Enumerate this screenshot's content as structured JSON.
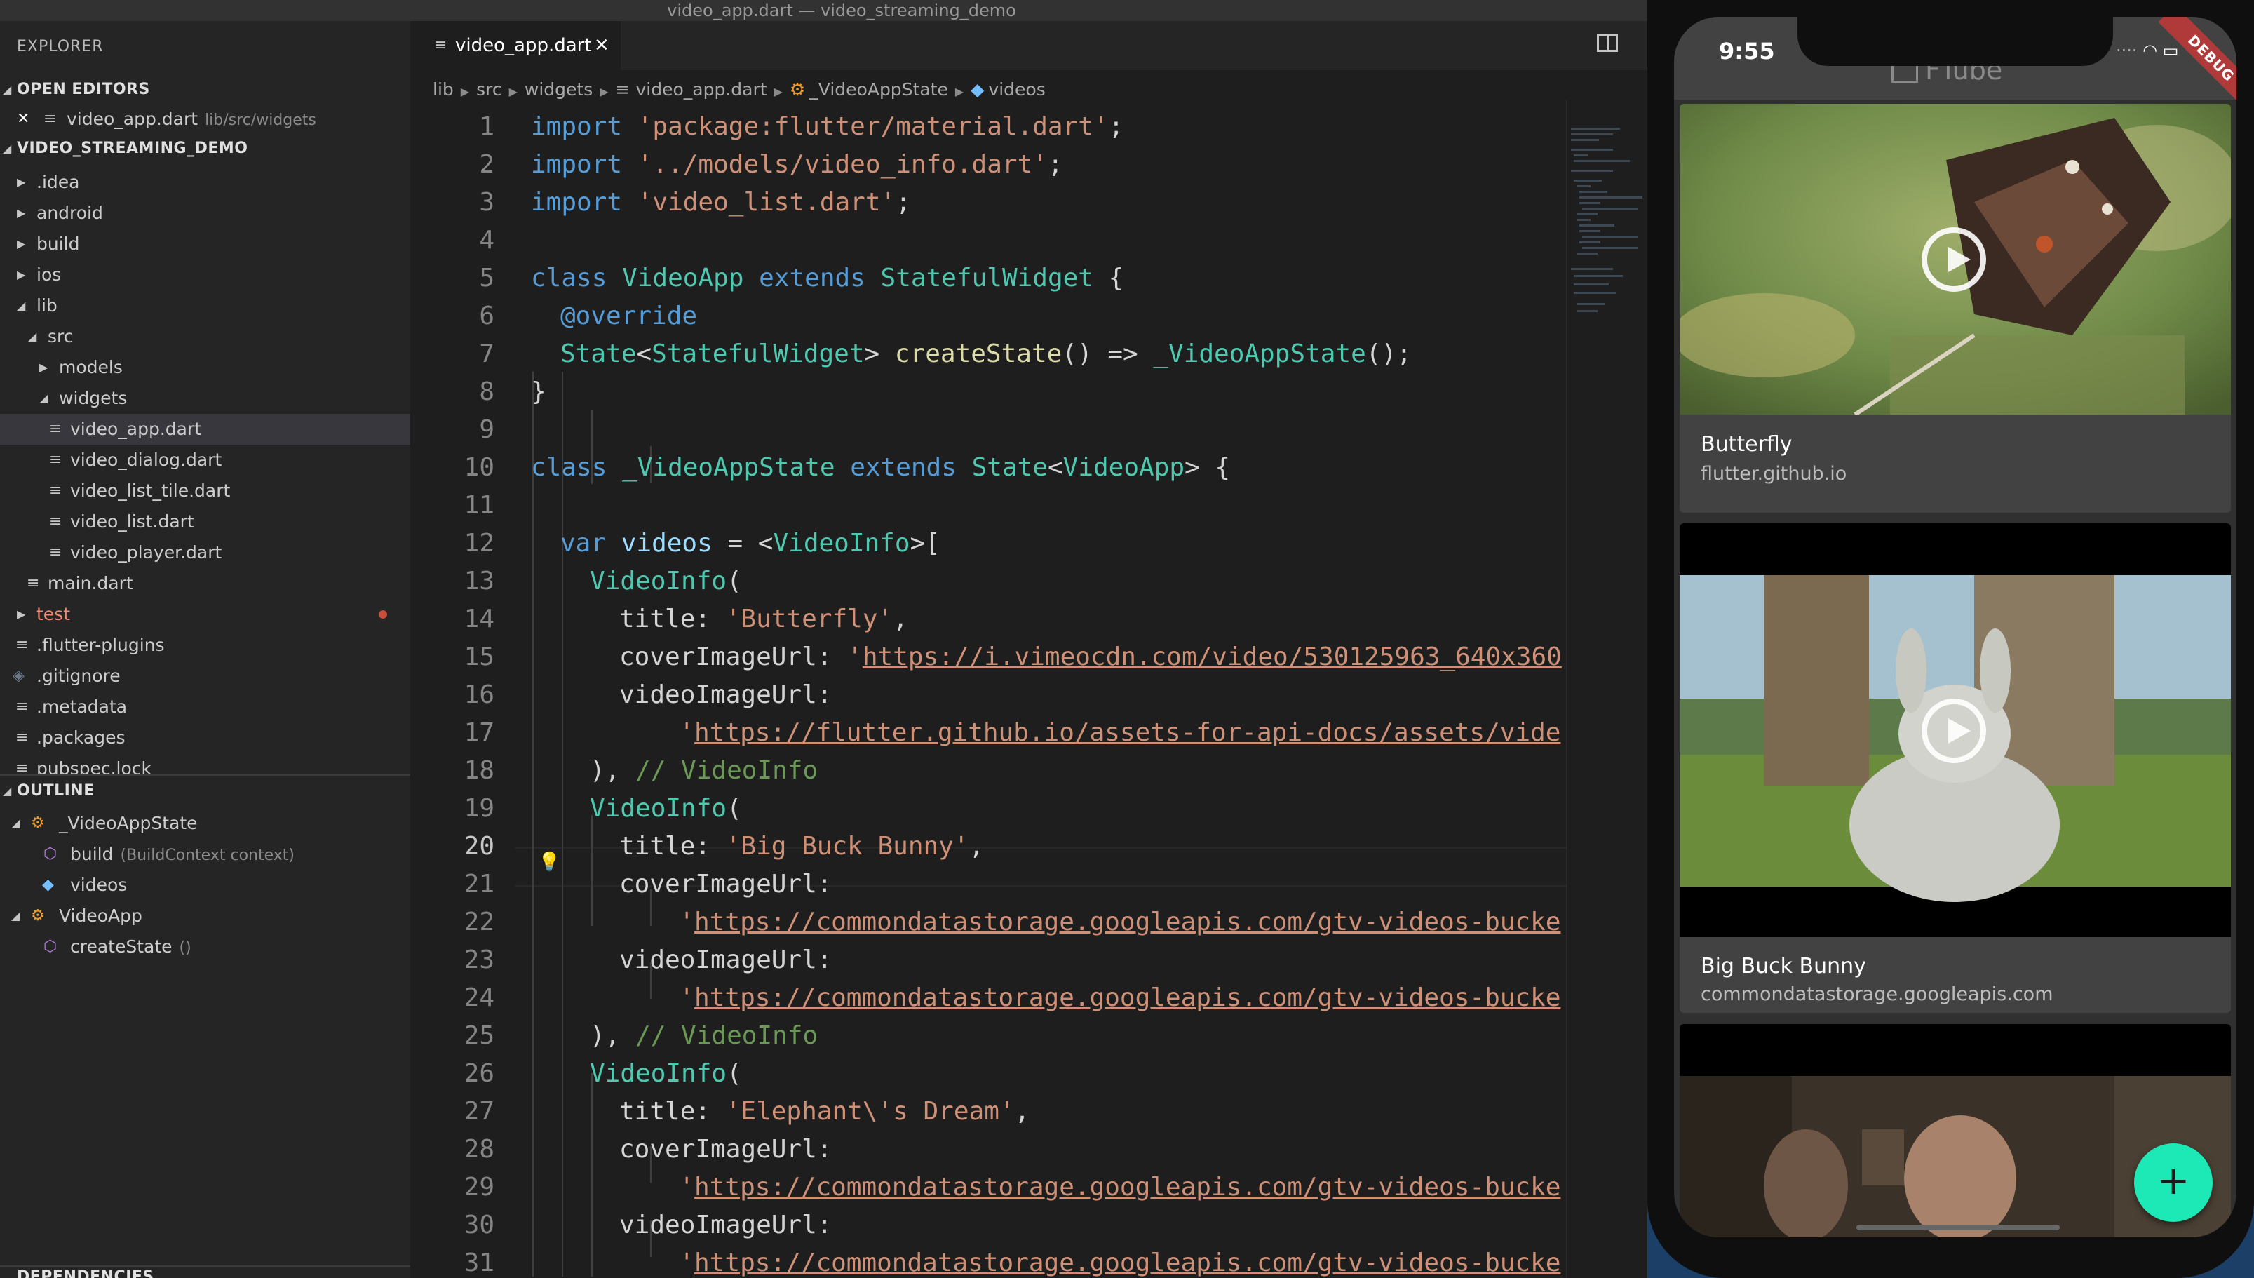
{
  "window": {
    "title": "video_app.dart — video_streaming_demo"
  },
  "sidebar": {
    "title": "EXPLORER",
    "open_editors": {
      "header": "OPEN EDITORS",
      "items": [
        {
          "name": "video_app.dart",
          "path": "lib/src/widgets"
        }
      ]
    },
    "project": {
      "header": "VIDEO_STREAMING_DEMO",
      "items": [
        {
          "label": ".idea"
        },
        {
          "label": "android"
        },
        {
          "label": "build"
        },
        {
          "label": "ios"
        },
        {
          "label": "lib"
        },
        {
          "label": "src"
        },
        {
          "label": "models"
        },
        {
          "label": "widgets"
        },
        {
          "label": "video_app.dart"
        },
        {
          "label": "video_dialog.dart"
        },
        {
          "label": "video_list_tile.dart"
        },
        {
          "label": "video_list.dart"
        },
        {
          "label": "video_player.dart"
        },
        {
          "label": "main.dart"
        },
        {
          "label": "test"
        },
        {
          "label": ".flutter-plugins"
        },
        {
          "label": ".gitignore"
        },
        {
          "label": ".metadata"
        },
        {
          "label": ".packages"
        },
        {
          "label": "pubspec.lock"
        }
      ]
    },
    "outline": {
      "header": "OUTLINE",
      "items": [
        {
          "label": "_VideoAppState"
        },
        {
          "label": "build",
          "hint": "(BuildContext context)"
        },
        {
          "label": "videos"
        },
        {
          "label": "VideoApp"
        },
        {
          "label": "createState",
          "hint": "()"
        }
      ]
    },
    "dependencies": {
      "header": "DEPENDENCIES"
    }
  },
  "editor": {
    "tab": {
      "label": "video_app.dart",
      "close": "✕"
    },
    "breadcrumb": [
      "lib",
      "src",
      "widgets",
      "video_app.dart",
      "_VideoAppState",
      "videos"
    ],
    "line_numbers": [
      "1",
      "2",
      "3",
      "4",
      "5",
      "6",
      "7",
      "8",
      "9",
      "10",
      "11",
      "12",
      "13",
      "14",
      "15",
      "16",
      "17",
      "18",
      "19",
      "20",
      "21",
      "22",
      "23",
      "24",
      "25",
      "26",
      "27",
      "28",
      "29",
      "30",
      "31"
    ],
    "current_line": "20",
    "code": {
      "l1": {
        "kw": "import",
        "str": "'package:flutter/material.dart'",
        "end": ";"
      },
      "l2": {
        "kw": "import",
        "str": "'../models/video_info.dart'",
        "end": ";"
      },
      "l3": {
        "kw": "import",
        "str": "'video_list.dart'",
        "end": ";"
      },
      "l5": {
        "kw": "class",
        "name": "VideoApp",
        "kw2": "extends",
        "type": "StatefulWidget",
        "end": "{"
      },
      "l6": {
        "ann": "@override"
      },
      "l7": {
        "type": "State",
        "lt": "<",
        "type2": "StatefulWidget",
        "gt": ">",
        "fn": "createState",
        "mid": "() => ",
        "type3": "_VideoAppState",
        "end": "();"
      },
      "l8": {
        "text": "}"
      },
      "l10": {
        "kw": "class",
        "name": "_VideoAppState",
        "kw2": "extends",
        "type": "State",
        "lt": "<",
        "type2": "VideoApp",
        "end": "> {"
      },
      "l12": {
        "kw": "var",
        "name": "videos",
        "mid": " = <",
        "type": "VideoInfo",
        "end": ">["
      },
      "l13": {
        "type": "VideoInfo",
        "end": "("
      },
      "l14": {
        "prop": "title:",
        "str": "'Butterfly'",
        "end": ","
      },
      "l15": {
        "prop": "coverImageUrl:",
        "q": "'",
        "url": "https://i.vimeocdn.com/video/530125963_640x360"
      },
      "l16": {
        "prop": "videoImageUrl:"
      },
      "l17": {
        "q": "'",
        "url": "https://flutter.github.io/assets-for-api-docs/assets/vide"
      },
      "l18": {
        "text": "), ",
        "cm": "// VideoInfo"
      },
      "l19": {
        "type": "VideoInfo",
        "end": "("
      },
      "l20": {
        "prop": "title:",
        "str": "'Big Buck Bunny'",
        "end": ","
      },
      "l21": {
        "prop": "coverImageUrl:"
      },
      "l22": {
        "q": "'",
        "url": "https://commondatastorage.googleapis.com/gtv-videos-bucke"
      },
      "l23": {
        "prop": "videoImageUrl:"
      },
      "l24": {
        "q": "'",
        "url": "https://commondatastorage.googleapis.com/gtv-videos-bucke"
      },
      "l25": {
        "text": "), ",
        "cm": "// VideoInfo"
      },
      "l26": {
        "type": "VideoInfo",
        "end": "("
      },
      "l27": {
        "prop": "title:",
        "str": "'Elephant\\'s Dream'",
        "end": ","
      },
      "l28": {
        "prop": "coverImageUrl:"
      },
      "l29": {
        "q": "'",
        "url": "https://commondatastorage.googleapis.com/gtv-videos-bucke"
      },
      "l30": {
        "prop": "videoImageUrl:"
      },
      "l31": {
        "q": "'",
        "url": "https://commondatastorage.googleapis.com/gtv-videos-bucke"
      }
    }
  },
  "phone": {
    "time": "9:55",
    "app_title": "FTube",
    "debug_banner": "DEBUG",
    "videos": [
      {
        "title": "Butterfly",
        "subtitle": "flutter.github.io"
      },
      {
        "title": "Big Buck Bunny",
        "subtitle": "commondatastorage.googleapis.com"
      },
      {
        "title": "",
        "subtitle": ""
      }
    ],
    "fab_icon": "+"
  },
  "colors": {
    "accent": "#1de9b6",
    "keyword": "#569cd6",
    "string": "#ce9178",
    "type": "#4ec9b0",
    "debug": "#b03a3a"
  }
}
